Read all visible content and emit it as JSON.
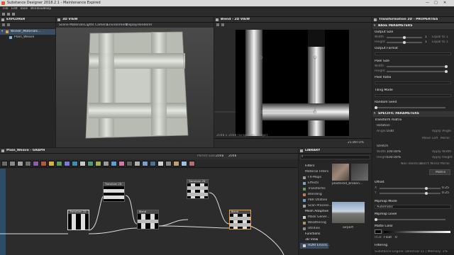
{
  "window": {
    "title": "Substance Designer 2018.2.1 - Maintenance Expired",
    "menu": [
      "File",
      "Edit",
      "Tools",
      "Windows",
      "Help"
    ]
  },
  "explorer": {
    "title": "EXPLORER",
    "items": [
      "Wicker_Materials...",
      "Plain_Weave"
    ]
  },
  "view3d": {
    "title": "3D VIEW",
    "menu": [
      "Scene",
      "Materials",
      "Lights",
      "Camera",
      "Environment",
      "Display",
      "Renderer"
    ]
  },
  "view2d": {
    "title": "Blend - 2D VIEW",
    "status": "2048 x 2048 (Grayscale, 16bpc)",
    "zoom": "21.8973%"
  },
  "graph": {
    "title": "Plain_Weave - GRAPH",
    "parent_size_label": "Parent Size:",
    "parent_size": "2048",
    "size": "2048",
    "nodes": [
      {
        "id": "n1",
        "label": "Transform 2D"
      },
      {
        "id": "n2",
        "label": "Transform 2D"
      },
      {
        "id": "n3",
        "label": "Blend"
      },
      {
        "id": "n4",
        "label": "Transform 2D"
      },
      {
        "id": "n5",
        "label": "Blend"
      }
    ]
  },
  "library": {
    "title": "LIBRARY",
    "search_placeholder": "",
    "categories": [
      {
        "label": "Filters",
        "header": true
      },
      {
        "label": "Material Filters",
        "header": false
      },
      {
        "label": "FX-Maps",
        "header": false
      },
      {
        "label": "Effects",
        "header": false
      },
      {
        "label": "Transforms",
        "header": false
      },
      {
        "label": "Blending",
        "header": false
      },
      {
        "label": "PBR Utilities",
        "header": false
      },
      {
        "label": "Scan Process...",
        "header": false
      },
      {
        "label": "Mesh Adaptive",
        "header": true
      },
      {
        "label": "Mask Gener...",
        "header": false
      },
      {
        "label": "Weathering",
        "header": false
      },
      {
        "label": "Utilities",
        "header": false
      },
      {
        "label": "Functions",
        "header": true
      },
      {
        "label": "3D View",
        "header": true
      },
      {
        "label": "HDRI Enviro...",
        "header": false
      }
    ],
    "thumb1_label": "plastered_broken...",
    "thumb2_label": "airport"
  },
  "properties": {
    "title": "Transformation 2D - PROPERTIES",
    "base_title": "BASE PARAMETERS",
    "output_size_label": "Output Size",
    "width_label": "Width",
    "height_label": "Height",
    "output_size_w": "1",
    "output_size_h": "1",
    "equal_w": "Equal to 1",
    "equal_h": "Equal to 1",
    "output_format_label": "Output Format",
    "pixel_size_label": "Pixel Size",
    "pixel_ratio_label": "Pixel Ratio",
    "tiling_mode_label": "Tiling Mode",
    "random_seed_label": "Random Seed",
    "specific_title": "SPECIFIC PARAMETERS",
    "transform_matrix_label": "Transform matrix",
    "rotation_label": "Rotation",
    "angle_label": "Angle",
    "angle_value": "0.00",
    "apply_angle": "Apply Angle",
    "rotate_buttons": [
      "Move",
      "Left",
      "Mirror"
    ],
    "stretch_label": "Stretch",
    "stretch_width_label": "Width",
    "stretch_width_value": "100.00%",
    "stretch_height_label": "Height",
    "stretch_height_value": "100.00%",
    "apply_width": "Apply Width",
    "apply_height": "Apply Height",
    "stretch_buttons": [
      "Non Identical",
      "Don't Mirror",
      "Mirror"
    ],
    "matrix_button": "Matrix",
    "offset_label": "Offset",
    "offset_x": "0.25",
    "offset_y": "0.25",
    "mipmap_mode_label": "Mipmap Mode",
    "mipmap_mode_value": "Automatic",
    "mipmap_level_label": "Mipmap Level",
    "matte_color_label": "Matte Color",
    "matte_type": "RGB",
    "matte_value": "Float",
    "matte_num": "0",
    "filtering_label": "Filtering"
  },
  "footer": {
    "status": "Substance Engine: Direct3D 11 | Memory: 1%"
  }
}
